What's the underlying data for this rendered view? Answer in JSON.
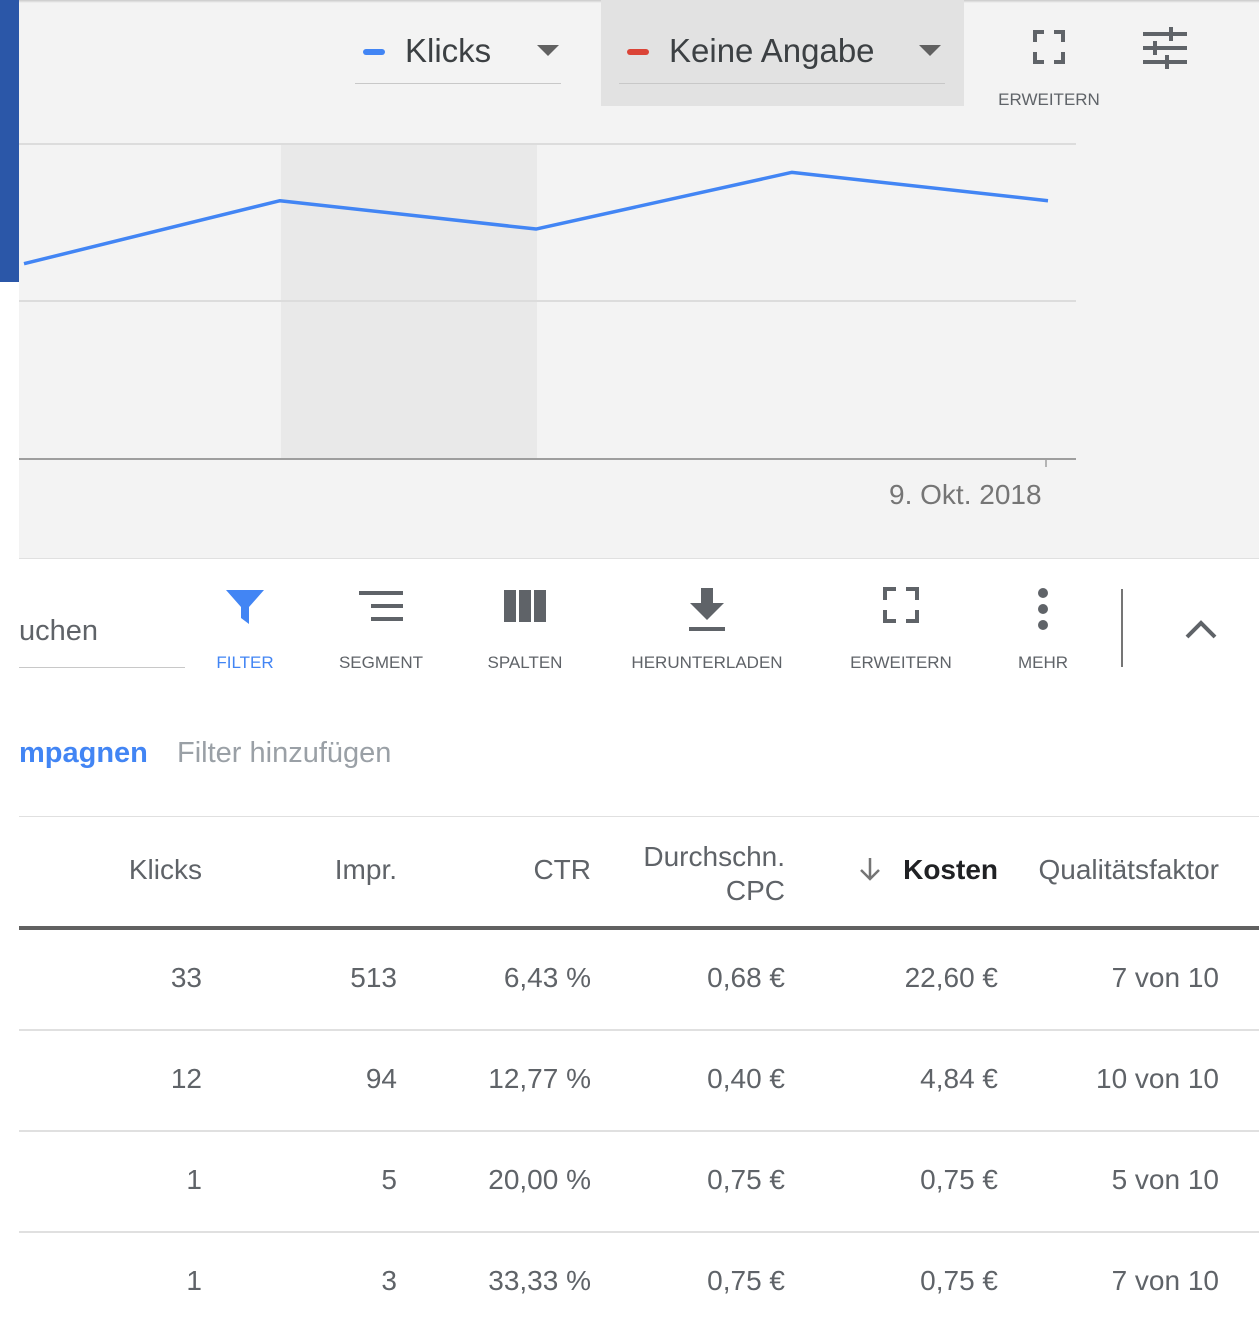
{
  "chart_header": {
    "metric1": {
      "label": "Klicks",
      "color": "#4285f4"
    },
    "metric2": {
      "label": "Keine Angabe",
      "color": "#db4437"
    },
    "expand_label": "ERWEITERN"
  },
  "chart_data": {
    "type": "line",
    "series": [
      {
        "values": [
          null,
          0.62,
          0.82,
          0.73,
          0.91,
          0.82
        ]
      }
    ],
    "x_labels": [
      "",
      "",
      "",
      "",
      "",
      "9. Okt. 2018"
    ],
    "grid": true,
    "ylim": [
      0,
      1
    ]
  },
  "toolbar": {
    "search_value": "uchen",
    "buttons": [
      {
        "label": "FILTER"
      },
      {
        "label": "SEGMENT"
      },
      {
        "label": "SPALTEN"
      },
      {
        "label": "HERUNTERLADEN"
      },
      {
        "label": "ERWEITERN"
      },
      {
        "label": "MEHR"
      }
    ]
  },
  "filter_bar": {
    "active_chip": "mpagnen",
    "add_filter": "Filter hinzufügen"
  },
  "table": {
    "headers": {
      "klicks": "Klicks",
      "impr": "Impr.",
      "ctr": "CTR",
      "cpc_line1": "Durchschn.",
      "cpc_line2": "CPC",
      "kosten": "Kosten",
      "qualitaetsfaktor": "Qualitätsfaktor"
    },
    "rows": [
      {
        "klicks": "33",
        "impr": "513",
        "ctr": "6,43 %",
        "cpc": "0,68 €",
        "kosten": "22,60 €",
        "qf": "7 von 10"
      },
      {
        "klicks": "12",
        "impr": "94",
        "ctr": "12,77 %",
        "cpc": "0,40 €",
        "kosten": "4,84 €",
        "qf": "10 von 10"
      },
      {
        "klicks": "1",
        "impr": "5",
        "ctr": "20,00 %",
        "cpc": "0,75 €",
        "kosten": "0,75 €",
        "qf": "5 von 10"
      },
      {
        "klicks": "1",
        "impr": "3",
        "ctr": "33,33 %",
        "cpc": "0,75 €",
        "kosten": "0,75 €",
        "qf": "7 von 10"
      }
    ]
  }
}
